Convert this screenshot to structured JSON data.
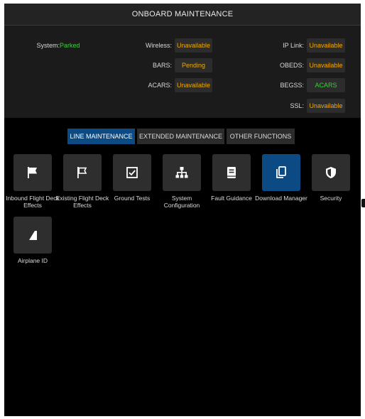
{
  "header": {
    "title": "ONBOARD MAINTENANCE"
  },
  "status": {
    "system": {
      "label": "System:",
      "value": "Parked",
      "color": "#35d435"
    },
    "wireless": {
      "label": "Wireless:",
      "value": "Unavailable"
    },
    "bars": {
      "label": "BARS:",
      "value": "Pending"
    },
    "acars_left": {
      "label": "ACARS:",
      "value": "Unavailable"
    },
    "ip_link": {
      "label": "IP Link:",
      "value": "Unavailable"
    },
    "obeds": {
      "label": "OBEDS:",
      "value": "Unavailable"
    },
    "begss": {
      "label": "BEGSS:",
      "value": "ACARS"
    },
    "ssl": {
      "label": "SSL:",
      "value": "Unavailable"
    }
  },
  "tabs": [
    {
      "label": "LINE MAINTENANCE",
      "active": true
    },
    {
      "label": "EXTENDED MAINTENANCE",
      "active": false
    },
    {
      "label": "OTHER FUNCTIONS",
      "active": false
    }
  ],
  "functions": [
    {
      "label": "Inbound Flight Deck Effects",
      "icon": "filled-flag-icon",
      "active": false
    },
    {
      "label": "Existing Flight Deck Effects",
      "icon": "outline-flag-icon",
      "active": false
    },
    {
      "label": "Ground Tests",
      "icon": "checkbox-icon",
      "active": false
    },
    {
      "label": "System Configuration",
      "icon": "hierarchy-icon",
      "active": false
    },
    {
      "label": "Fault Guidance",
      "icon": "manual-book-icon",
      "active": false
    },
    {
      "label": "Download Manager",
      "icon": "copy-documents-icon",
      "active": true
    },
    {
      "label": "Security",
      "icon": "shield-icon",
      "active": false
    },
    {
      "label": "Airplane ID",
      "icon": "airplane-tail-icon",
      "active": false
    }
  ],
  "colors": {
    "accent": "#0c4a84",
    "unavailable": "#f2a900",
    "ok": "#35d435",
    "background": "#000000",
    "panel": "#1b1b1b",
    "tile": "#2e2e2e"
  }
}
